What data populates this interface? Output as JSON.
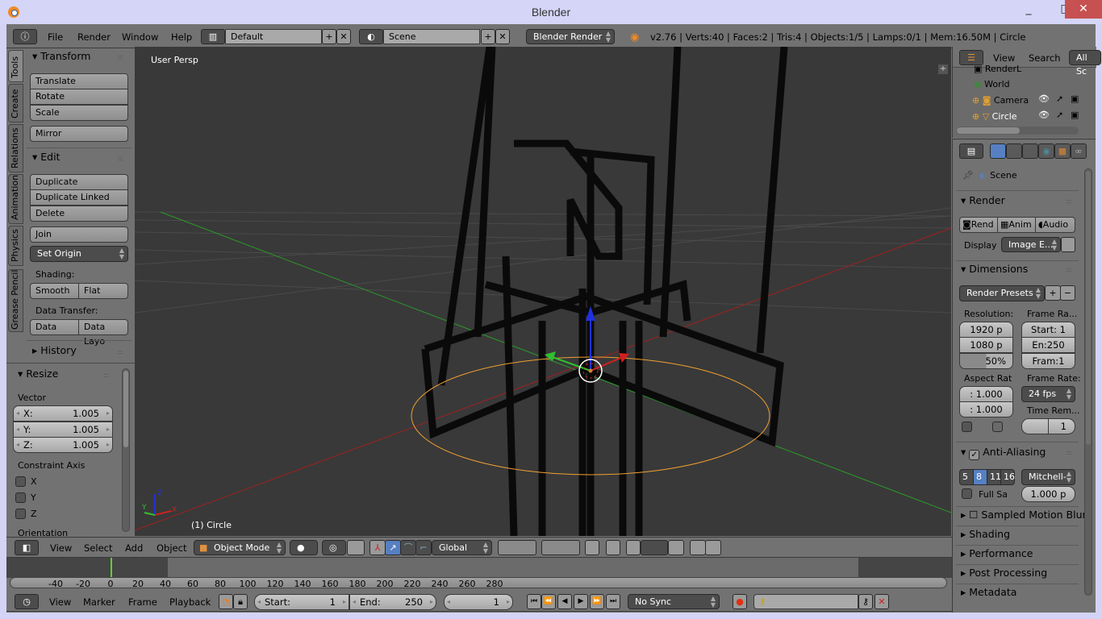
{
  "window": {
    "title": "Blender",
    "minimize": "_",
    "maximize": "□",
    "close": "✕"
  },
  "info_header": {
    "menus": [
      "File",
      "Render",
      "Window",
      "Help"
    ],
    "screen_layout": "Default",
    "scene": "Scene",
    "render_engine": "Blender Render",
    "stats": "v2.76 | Verts:40 | Faces:2 | Tris:4 | Objects:1/5 | Lamps:0/1 | Mem:16.50M | Circle"
  },
  "tool_tabs": [
    "Tools",
    "Create",
    "Relations",
    "Animation",
    "Physics",
    "Grease Pencil"
  ],
  "tools_panel": {
    "transform": {
      "title": "Transform",
      "buttons": [
        "Translate",
        "Rotate",
        "Scale"
      ],
      "mirror": "Mirror"
    },
    "edit": {
      "title": "Edit",
      "buttons": [
        "Duplicate",
        "Duplicate Linked",
        "Delete"
      ],
      "join": "Join",
      "set_origin": "Set Origin",
      "shading_label": "Shading:",
      "shading": [
        "Smooth",
        "Flat"
      ],
      "data_transfer_label": "Data Transfer:",
      "data_transfer": [
        "Data",
        "Data Layo"
      ]
    },
    "history": {
      "title": "History"
    }
  },
  "operator_panel": {
    "title": "Resize",
    "vector_label": "Vector",
    "vector": [
      {
        "k": "X:",
        "v": "1.005"
      },
      {
        "k": "Y:",
        "v": "1.005"
      },
      {
        "k": "Z:",
        "v": "1.005"
      }
    ],
    "constraint_label": "Constraint Axis",
    "constraints": [
      {
        "label": "X",
        "checked": false
      },
      {
        "label": "Y",
        "checked": false
      },
      {
        "label": "Z",
        "checked": false
      }
    ],
    "orientation_label": "Orientation"
  },
  "viewport": {
    "view_name": "User Persp",
    "object_label": "(1) Circle",
    "axis_labels": {
      "x": "X",
      "y": "Y",
      "z": "Z"
    }
  },
  "view3d_header": {
    "menus": [
      "View",
      "Select",
      "Add",
      "Object"
    ],
    "mode": "Object Mode",
    "orientation": "Global"
  },
  "timeline": {
    "ticks": [
      "-40",
      "-20",
      "0",
      "20",
      "40",
      "60",
      "80",
      "100",
      "120",
      "140",
      "160",
      "180",
      "200",
      "220",
      "240",
      "260",
      "280"
    ],
    "current_frame_value": 0,
    "menus": [
      "View",
      "Marker",
      "Frame",
      "Playback"
    ],
    "start_label": "Start:",
    "start": "1",
    "end_label": "End:",
    "end": "250",
    "current": "1",
    "sync": "No Sync"
  },
  "outliner": {
    "menus": [
      "View",
      "Search"
    ],
    "filter": "All Sc",
    "items": [
      {
        "label": "RenderL",
        "icon": "render-layers-icon"
      },
      {
        "label": "World",
        "icon": "world-icon"
      },
      {
        "label": "Camera",
        "icon": "camera-icon"
      },
      {
        "label": "Circle",
        "icon": "mesh-icon"
      }
    ]
  },
  "properties": {
    "context": "Scene",
    "render": {
      "title": "Render",
      "buttons": [
        "Rend",
        "Anim",
        "Audio"
      ],
      "display_label": "Display",
      "display": "Image E..."
    },
    "dimensions": {
      "title": "Dimensions",
      "presets": "Render Presets",
      "resolution_label": "Resolution:",
      "res_x": "1920 p",
      "res_y": "1080 p",
      "res_pct": "50%",
      "res_pct_value": 50,
      "frame_range_label": "Frame Ra...",
      "start": "Start: 1",
      "end": "En:250",
      "step": "Fram:1",
      "aspect_label": "Aspect Rat",
      "aspect_x": ": 1.000",
      "aspect_y": ": 1.000",
      "frame_rate_label": "Frame Rate:",
      "frame_rate": "24 fps",
      "time_remap_label": "Time Rem...",
      "time_remap": "1"
    },
    "anti_aliasing": {
      "title": "Anti-Aliasing",
      "enabled": true,
      "samples": [
        "5",
        "8",
        "11",
        "16"
      ],
      "selected": "8",
      "filter": "Mitchell-",
      "full_sample": "Full Sa",
      "size": "1.000 p"
    },
    "collapsed": [
      "Sampled Motion Blur",
      "Shading",
      "Performance",
      "Post Processing",
      "Metadata"
    ]
  },
  "colors": {
    "accent": "#5680c2",
    "x_axis": "#d02020",
    "y_axis": "#30c030",
    "z_axis": "#2030e0",
    "selection": "#f0a030",
    "frame_marker": "#60d030"
  }
}
